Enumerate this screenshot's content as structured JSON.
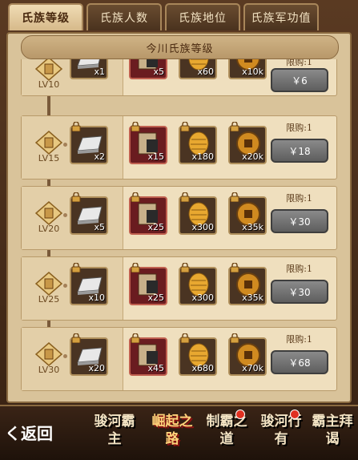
{
  "tabs": [
    {
      "label": "氏族等级",
      "active": true
    },
    {
      "label": "氏族人数",
      "active": false
    },
    {
      "label": "氏族地位",
      "active": false
    },
    {
      "label": "氏族军功值",
      "active": false
    }
  ],
  "title": "今川氏族等级",
  "rows": [
    {
      "level": "LV10",
      "items": [
        "x1",
        "x5",
        "x60",
        "x10k"
      ],
      "limit": "限购:1",
      "price": "￥6"
    },
    {
      "level": "LV15",
      "items": [
        "x2",
        "x15",
        "x180",
        "x20k"
      ],
      "limit": "限购:1",
      "price": "￥18"
    },
    {
      "level": "LV20",
      "items": [
        "x5",
        "x25",
        "x300",
        "x35k"
      ],
      "limit": "限购:1",
      "price": "￥30"
    },
    {
      "level": "LV25",
      "items": [
        "x10",
        "x25",
        "x300",
        "x35k"
      ],
      "limit": "限购:1",
      "price": "￥30"
    },
    {
      "level": "LV30",
      "items": [
        "x20",
        "x45",
        "x680",
        "x70k"
      ],
      "limit": "限购:1",
      "price": "￥68"
    }
  ],
  "item_icons": [
    "silver-ingot-icon",
    "scroll-icon",
    "gold-cookie-icon",
    "coin-icon"
  ],
  "bottom_nav": {
    "back_label": "く返回",
    "items": [
      {
        "label": "骏河霸主",
        "active": false,
        "badge": false
      },
      {
        "label": "崛起之路",
        "active": true,
        "badge": false
      },
      {
        "label": "制霸之道",
        "active": false,
        "badge": true
      },
      {
        "label": "骏河行有",
        "active": false,
        "badge": true
      },
      {
        "label": "霸主拜谒",
        "active": false,
        "badge": false
      }
    ]
  },
  "colors": {
    "accent": "#ffd27a",
    "badge": "#e03020",
    "panel": "#d9c39a"
  }
}
